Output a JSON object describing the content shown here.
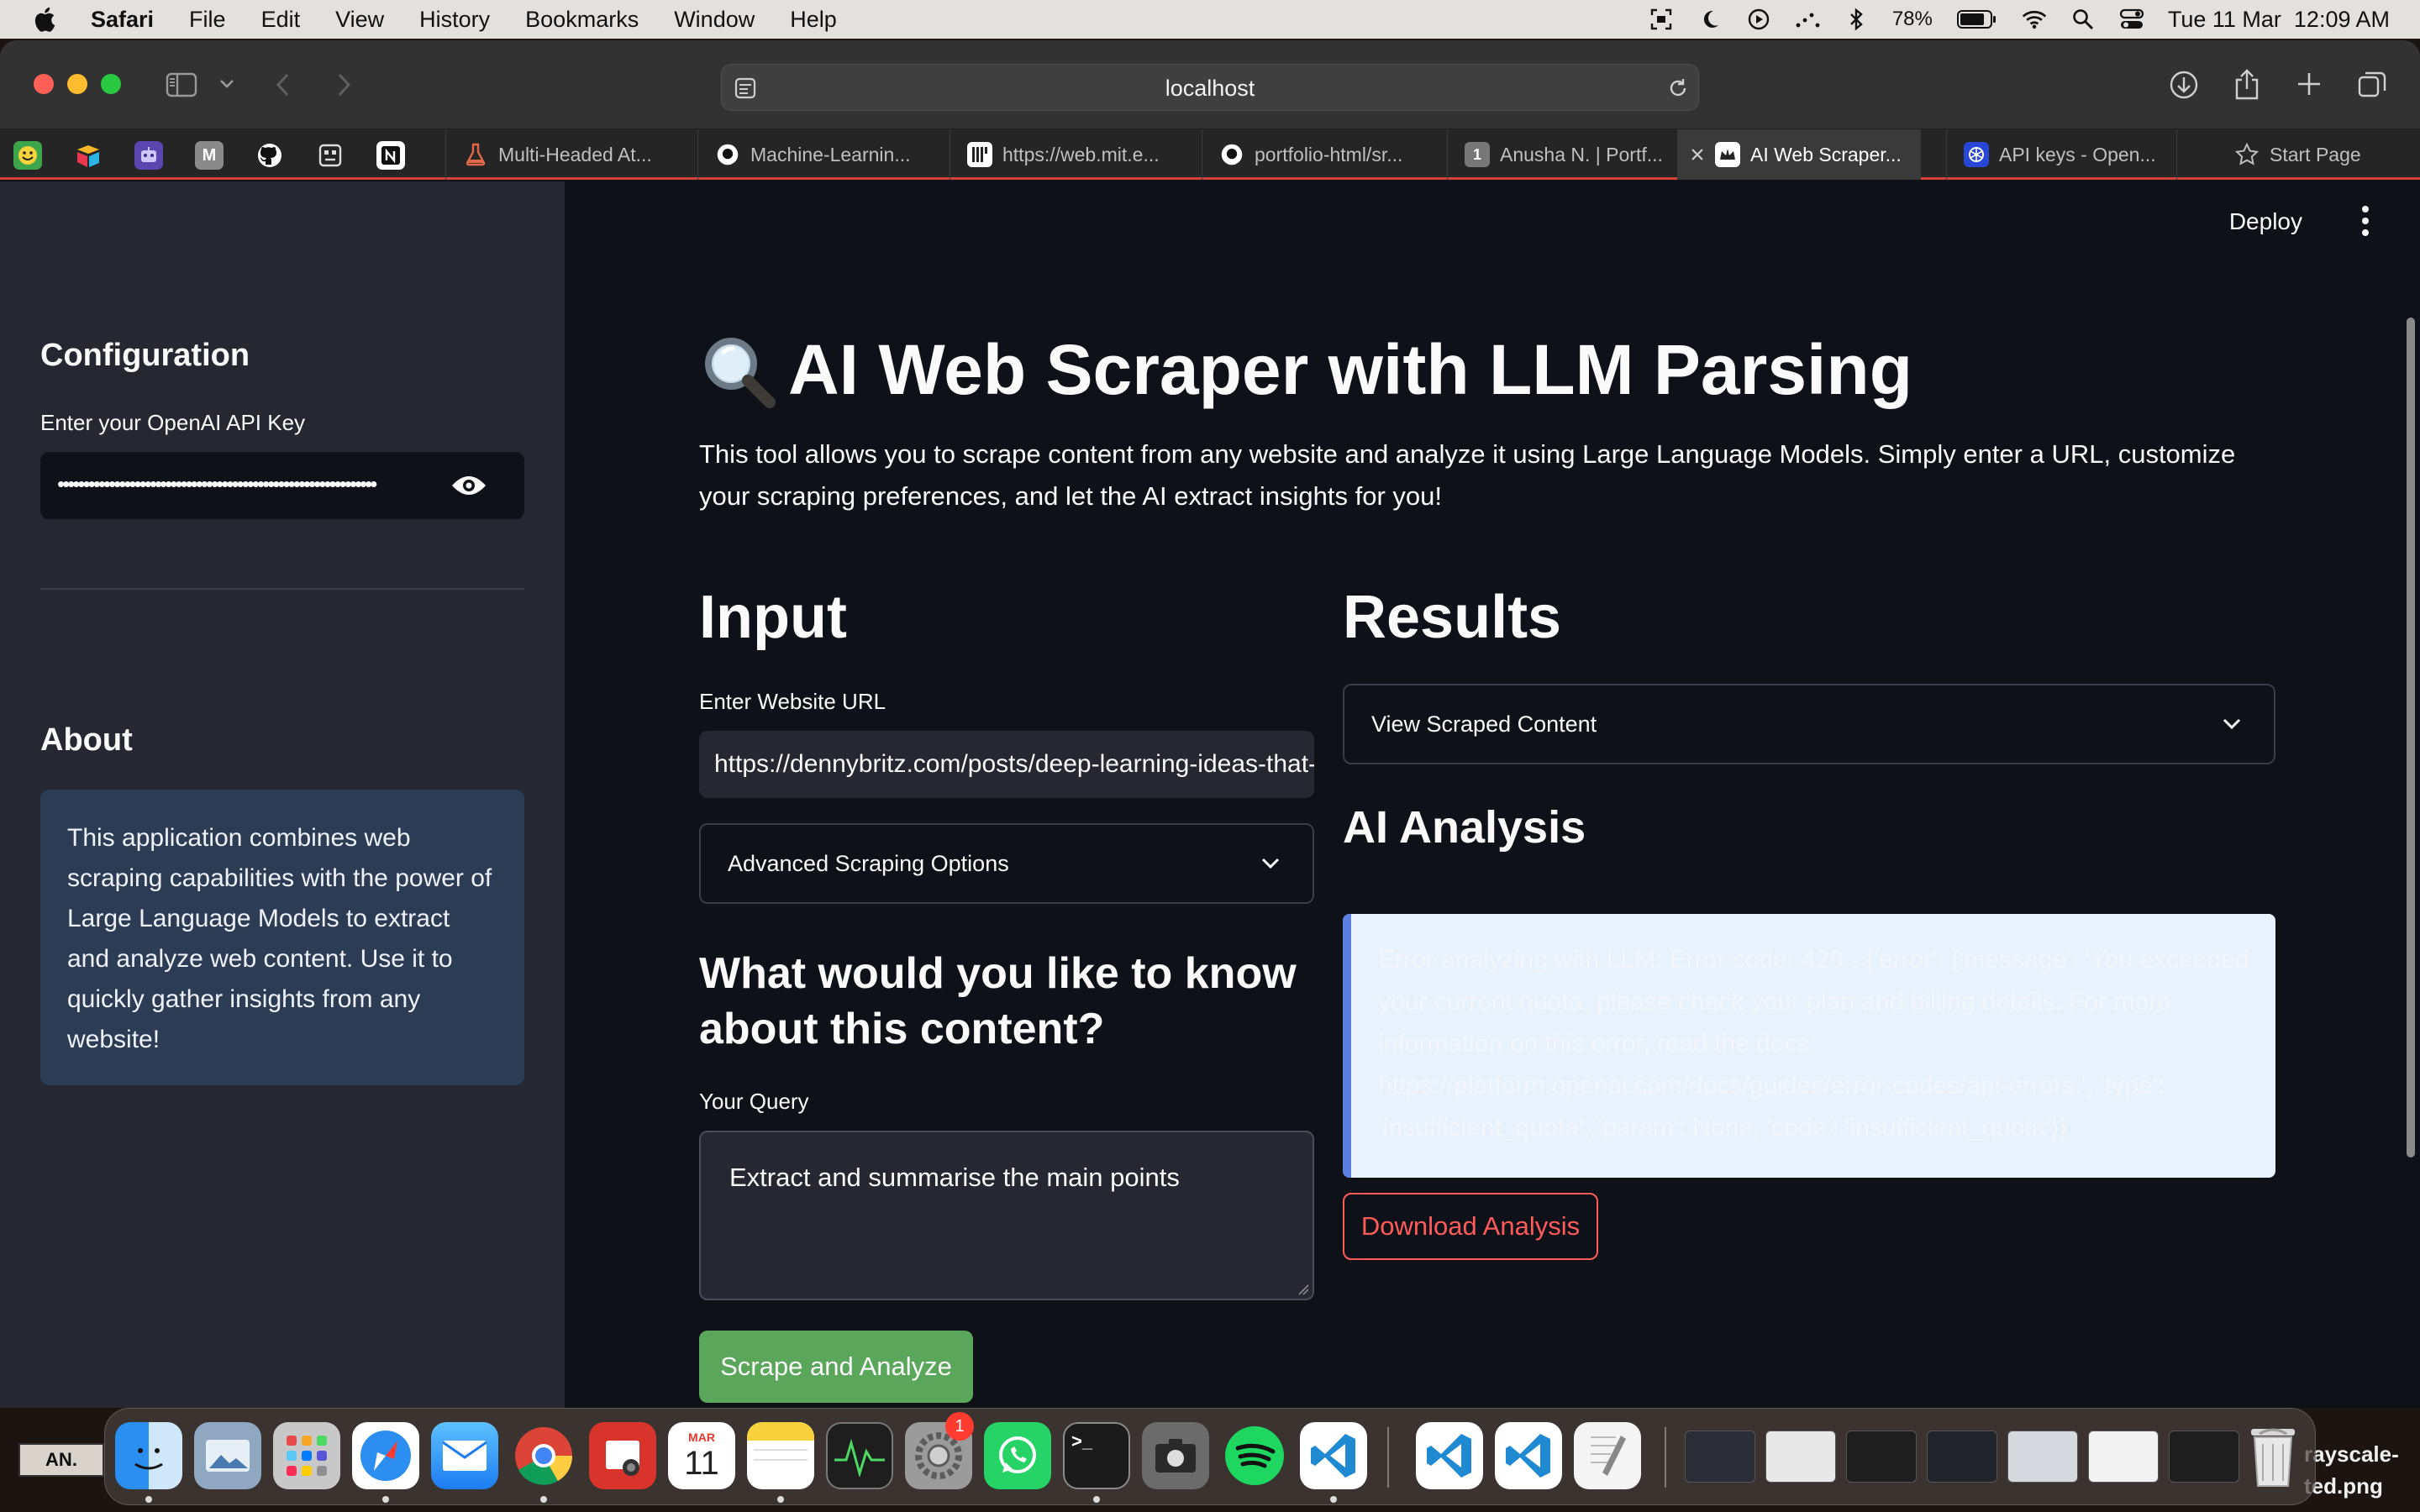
{
  "menubar": {
    "app": "Safari",
    "items": [
      "File",
      "Edit",
      "View",
      "History",
      "Bookmarks",
      "Window",
      "Help"
    ],
    "battery": "78%",
    "datetime": "Tue 11 Mar  12:09 AM"
  },
  "browser": {
    "url": "localhost",
    "tabs": [
      {
        "label": "Multi-Headed At..."
      },
      {
        "label": "Machine-Learnin..."
      },
      {
        "label": "https://web.mit.e..."
      },
      {
        "label": "portfolio-html/sr..."
      },
      {
        "label": "Anusha N. | Portf..."
      },
      {
        "label": "AI Web Scraper..."
      },
      {
        "label": "API keys - Open..."
      },
      {
        "label": "Start Page"
      }
    ],
    "pinned_letters": {
      "m": "M",
      "one": "1"
    }
  },
  "sidebar": {
    "config_heading": "Configuration",
    "api_key_label": "Enter your OpenAI API Key",
    "api_key_masked": "••••••••••••••••••••••••••••••••••••••••••••••••••••••••••••••",
    "about_heading": "About",
    "about_text": "This application combines web scraping capabilities with the power of Large Language Models to extract and analyze web content. Use it to quickly gather insights from any website!"
  },
  "header": {
    "deploy": "Deploy"
  },
  "main": {
    "title": "AI Web Scraper with LLM Parsing",
    "description": "This tool allows you to scrape content from any website and analyze it using Large Language Models. Simply enter a URL, customize your scraping preferences, and let the AI extract insights for you!",
    "input_heading": "Input",
    "url_label": "Enter Website URL",
    "url_value": "https://dennybritz.com/posts/deep-learning-ideas-that-have-stood-the-test-of-time/",
    "advanced_options": "Advanced Scraping Options",
    "question_heading": "What would you like to know about this content?",
    "query_label": "Your Query",
    "query_value": "Extract and summarise the main points",
    "scrape_button": "Scrape and Analyze",
    "results_heading": "Results",
    "view_scraped": "View Scraped Content",
    "analysis_heading": "AI Analysis",
    "error_text": "Error analyzing with LLM: Error code: 429 - {'error': {'message': 'You exceeded your current quota, please check your plan and billing details. For more information on this error, read the docs: https://platform.openai.com/docs/guides/error-codes/api-errors.', 'type': 'insufficient_quota', 'param': None, 'code': 'insufficient_quota'}}",
    "download_button": "Download Analysis"
  },
  "desktop": {
    "left_label": "AN.",
    "right_label_1": "rayscale-",
    "right_label_2": "ted.png"
  },
  "dock": {
    "calendar_month": "MAR",
    "calendar_day": "11",
    "settings_badge": "1",
    "terminal_prompt": ">_"
  },
  "colors": {
    "accent_red": "#ff4b4b",
    "button_green": "#5aa65a",
    "sidebar": "#262730",
    "background": "#0e1117",
    "info_bg": "#e8f2fc"
  }
}
